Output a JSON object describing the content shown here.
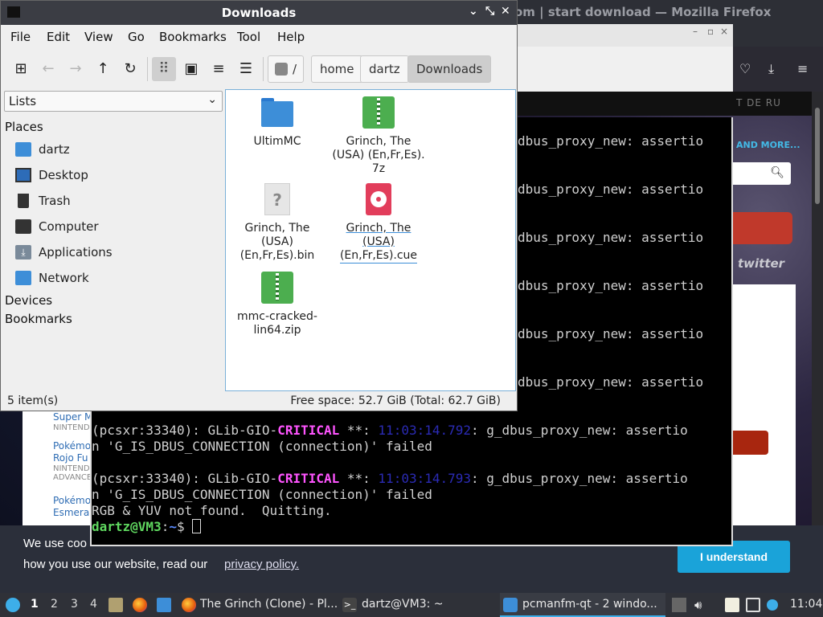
{
  "firefox": {
    "title": "om | start download — Mozilla Firefox",
    "lang_codes": "T  DE  RU",
    "and_more": "AND MORE...",
    "twitter": "twitter",
    "cookie_line1": "We use coo",
    "cookie_line2": "how you use our website, read our",
    "cookie_link": "privacy policy.",
    "cookie_button": "I understand",
    "list": [
      {
        "title": "Super M",
        "sub": "NINTENDO"
      },
      {
        "title": "Pokémo",
        "title2": "Rojo Fu",
        "sub": "NINTEND",
        "sub2": "ADVANCE"
      },
      {
        "title": "Pokémo",
        "title2": "Esmeral",
        "sub": ""
      }
    ]
  },
  "terminal": {
    "lines": [
      {
        "pre": "",
        "crit": "",
        "ts": "",
        "post": "dbus_proxy_new: assertio"
      },
      {
        "pre": "",
        "crit": "",
        "ts": "",
        "post": "dbus_proxy_new: assertio"
      },
      {
        "pre": "",
        "crit": "",
        "ts": "",
        "post": "dbus_proxy_new: assertio"
      },
      {
        "pre": "",
        "crit": "",
        "ts": "",
        "post": "dbus_proxy_new: assertio"
      },
      {
        "pre": "",
        "crit": "",
        "ts": "",
        "post": "dbus_proxy_new: assertio"
      },
      {
        "pre": "",
        "crit": "",
        "ts": "",
        "post": "dbus_proxy_new: assertio"
      }
    ],
    "full1_pre": "(pcsxr:33340): GLib-GIO-",
    "full1_crit": "CRITICAL",
    "full1_mid": " **: ",
    "full1_ts": "11:03:14.792",
    "full1_post": ": g_dbus_proxy_new: assertio",
    "full1_cont": "n 'G_IS_DBUS_CONNECTION (connection)' failed",
    "full2_pre": "(pcsxr:33340): GLib-GIO-",
    "full2_crit": "CRITICAL",
    "full2_mid": " **: ",
    "full2_ts": "11:03:14.793",
    "full2_post": ": g_dbus_proxy_new: assertio",
    "full2_cont": "n 'G_IS_DBUS_CONNECTION (connection)' failed",
    "quit_line": "RGB & YUV not found.  Quitting.",
    "prompt_user": "dartz@VM3",
    "prompt_colon": ":",
    "prompt_path": "~",
    "prompt_sym": "$ "
  },
  "filemanager": {
    "title": "Downloads",
    "menu": [
      "File",
      "Edit",
      "View",
      "Go",
      "Bookmarks",
      "Tool",
      "Help"
    ],
    "breadcrumb": {
      "root": "/",
      "parts": [
        "home",
        "dartz",
        "Downloads"
      ]
    },
    "side_combo": "Lists",
    "places_label": "Places",
    "places": [
      "dartz",
      "Desktop",
      "Trash",
      "Computer",
      "Applications",
      "Network"
    ],
    "devices_label": "Devices",
    "bookmarks_label": "Bookmarks",
    "files": [
      {
        "name": "UltimMC",
        "type": "folder"
      },
      {
        "name": "Grinch, The (USA) (En,Fr,Es).7z",
        "line1": "Grinch, The",
        "line2": "(USA) (En,Fr,Es).",
        "line3": "7z",
        "type": "archive"
      },
      {
        "name": "Grinch, The (USA) (En,Fr,Es).bin",
        "line1": "Grinch, The",
        "line2": "(USA)",
        "line3": "(En,Fr,Es).bin",
        "type": "unknown"
      },
      {
        "name": "Grinch, The (USA) (En,Fr,Es).cue",
        "line1": "Grinch, The",
        "line2": "(USA)",
        "line3": "(En,Fr,Es).cue",
        "type": "disc"
      },
      {
        "name": "mmc-cracked-lin64.zip",
        "line1": "mmc-cracked-",
        "line2": "lin64.zip",
        "type": "archive"
      }
    ],
    "status_count": "5 item(s)",
    "status_space": "Free space: 52.7 GiB (Total: 62.7 GiB)"
  },
  "taskbar": {
    "workspaces": [
      "1",
      "2",
      "3",
      "4"
    ],
    "tasks": [
      {
        "label": "The Grinch (Clone) - Pl...",
        "icon": "firefox-icon"
      },
      {
        "label": "dartz@VM3: ~",
        "icon": "terminal-icon"
      },
      {
        "label": "pcmanfm-qt - 2 windo...",
        "icon": "folder-icon"
      }
    ],
    "clock": "11:04"
  },
  "colors": {
    "accent": "#3daee9",
    "archive_green": "#4cae4f",
    "folder_blue": "#3d8ed8",
    "disc_red": "#e23d5b"
  }
}
